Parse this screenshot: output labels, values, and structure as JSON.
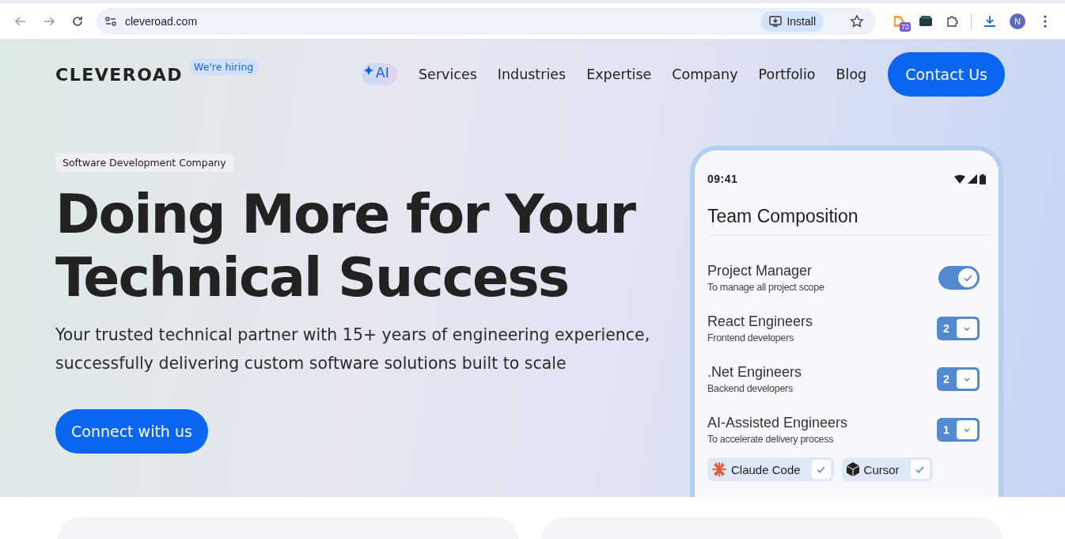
{
  "browser": {
    "url": "cleveroad.com",
    "install_label": "Install",
    "extension_badge": "72",
    "profile_initial": "N"
  },
  "header": {
    "logo": "CLEVEROAD",
    "hiring_badge": "We're hiring",
    "nav": [
      {
        "label": "AI",
        "kind": "ai"
      },
      {
        "label": "Services",
        "kind": "plain"
      },
      {
        "label": "Industries",
        "kind": "plain"
      },
      {
        "label": "Expertise",
        "kind": "plain"
      },
      {
        "label": "Company",
        "kind": "plain"
      },
      {
        "label": "Portfolio",
        "kind": "plain"
      },
      {
        "label": "Blog",
        "kind": "plain"
      }
    ],
    "cta": "Contact Us"
  },
  "hero": {
    "eyebrow": "Software Development Company",
    "title_lines": [
      "Doing More for Your",
      "Technical Success"
    ],
    "subtitle": "Your trusted technical partner with 15+ years of engineering experience, successfully delivering custom software solutions built to scale",
    "button": "Connect with us"
  },
  "phone": {
    "time": "09:41",
    "title": "Team Composition",
    "roles": [
      {
        "kind": "toggle",
        "name": "Project Manager",
        "note": "To manage all project scope",
        "on": true
      },
      {
        "kind": "count",
        "name": "React Engineers",
        "note": "Frontend developers",
        "count": "2"
      },
      {
        "kind": "count",
        "name": ".Net Engineers",
        "note": "Backend developers",
        "count": "2"
      },
      {
        "kind": "count",
        "name": "AI-Assisted Engineers",
        "note": "To accelerate delivery process",
        "count": "1"
      }
    ],
    "tools": [
      {
        "name": "Claude Code",
        "kind": "burst",
        "checked": true
      },
      {
        "name": "Cursor",
        "kind": "cube",
        "checked": true
      }
    ]
  }
}
